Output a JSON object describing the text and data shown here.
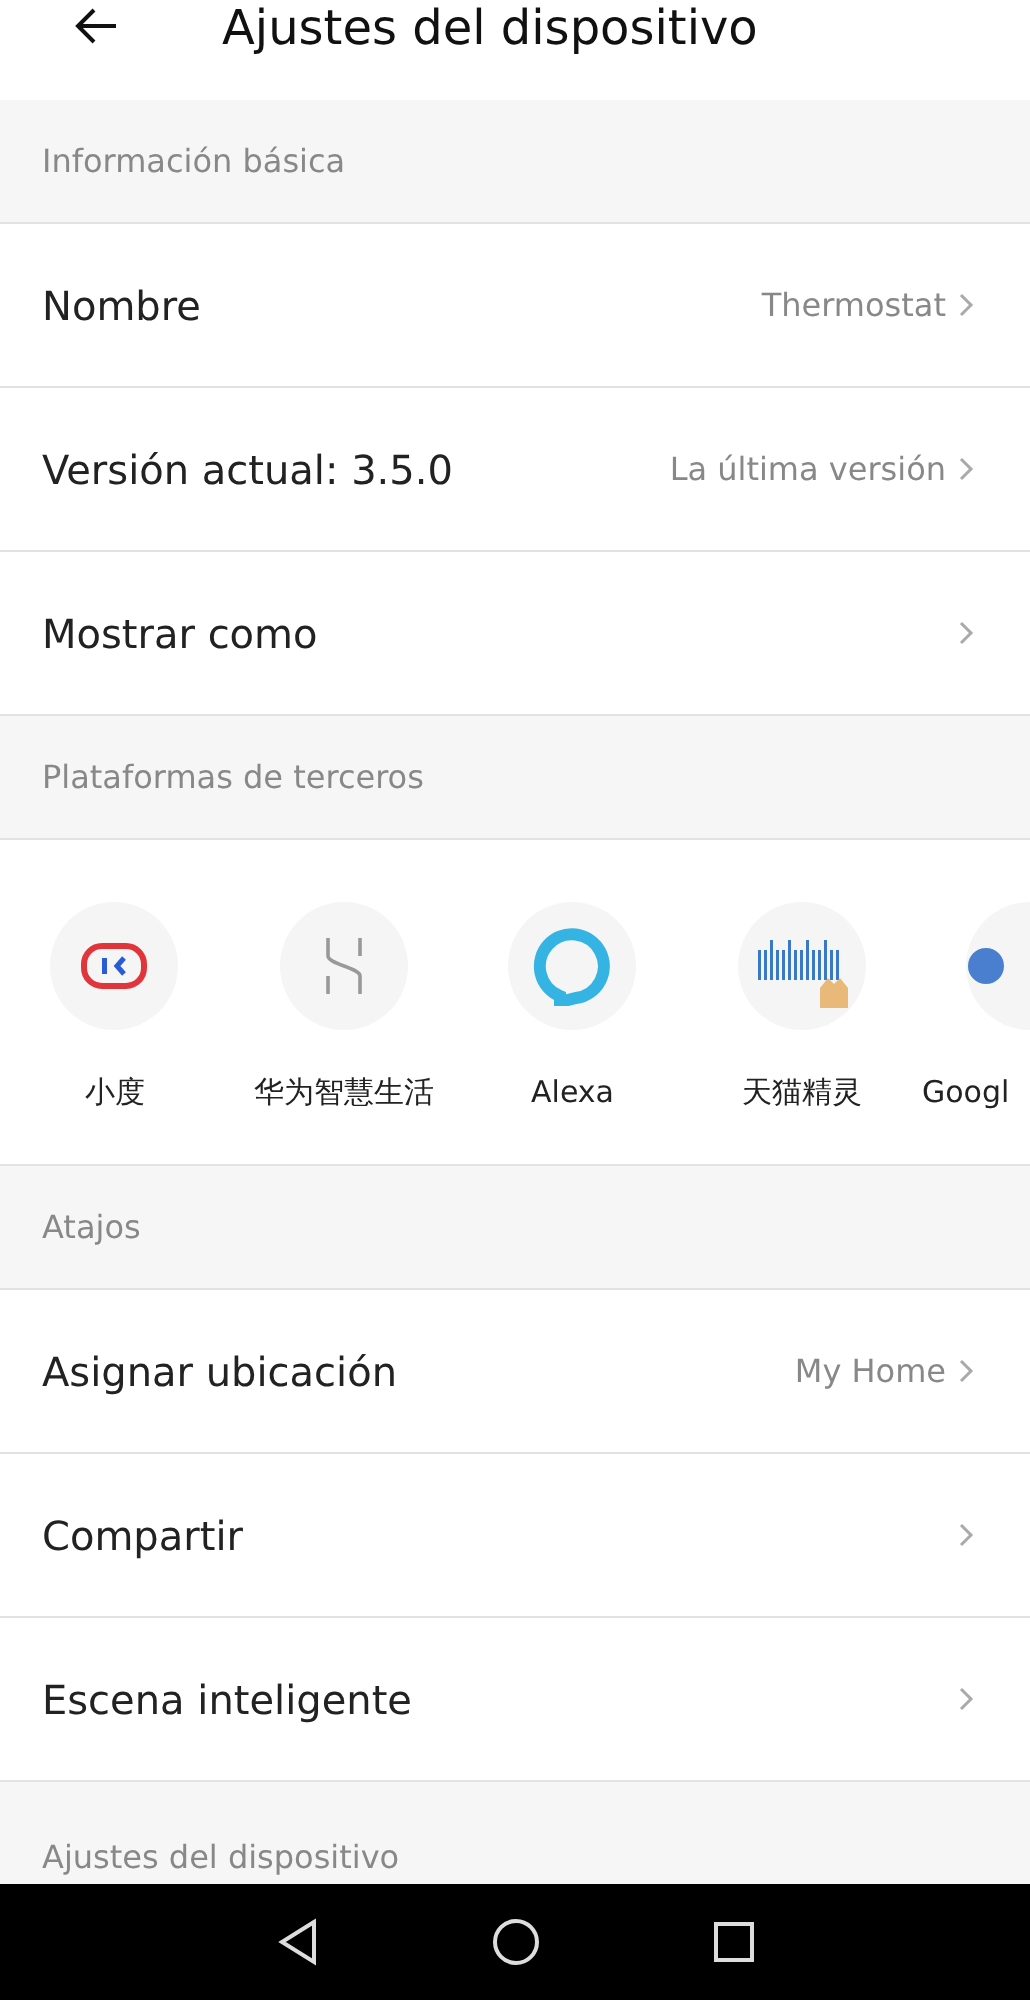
{
  "header": {
    "title": "Ajustes del dispositivo"
  },
  "sections": [
    {
      "kind": "rows",
      "title": "Información básica",
      "rows": [
        {
          "label": "Nombre",
          "value": "Thermostat"
        },
        {
          "label": "Versión actual:  3.5.0",
          "value": "La última versión"
        },
        {
          "label": "Mostrar como"
        }
      ]
    },
    {
      "kind": "platforms",
      "title": "Plataformas de terceros",
      "platforms": [
        {
          "label": "小度"
        },
        {
          "label": "华为智慧生活"
        },
        {
          "label": "Alexa"
        },
        {
          "label": "天猫精灵"
        },
        {
          "label": "Googl"
        }
      ]
    },
    {
      "kind": "rows",
      "title": "Atajos",
      "rows": [
        {
          "label": "Asignar ubicación",
          "value": "My Home"
        },
        {
          "label": "Compartir"
        },
        {
          "label": "Escena inteligente"
        }
      ]
    },
    {
      "kind": "label",
      "title": "Ajustes del dispositivo"
    }
  ]
}
